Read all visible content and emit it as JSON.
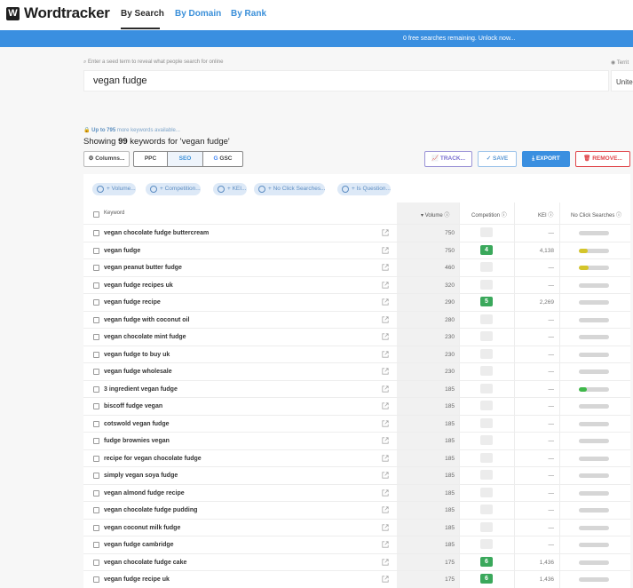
{
  "app": {
    "logo_mark": "W",
    "logo_text": "Wordtracker",
    "tabs": [
      {
        "label": "By Search",
        "active": true
      },
      {
        "label": "By Domain",
        "active": false
      },
      {
        "label": "By Rank",
        "active": false
      }
    ]
  },
  "banner": {
    "text": "0 free searches remaining. Unlock now..."
  },
  "search": {
    "hint": "Enter a seed term to reveal what people search for online",
    "value": "vegan fudge",
    "territory_hint": "Territ",
    "territory_value": "Unite"
  },
  "results": {
    "available_prefix": "Up to 795",
    "available_suffix": " more keywords available...",
    "showing_prefix": "Showing ",
    "showing_count": "99",
    "showing_suffix": " keywords for 'vegan fudge'"
  },
  "toolbar": {
    "columns_label": "Columns...",
    "ppc_label": "PPC",
    "seo_label": "SEO",
    "gsc_label": "GSC",
    "track_label": "TRACK...",
    "save_label": "SAVE",
    "export_label": "EXPORT",
    "remove_label": "REMOVE..."
  },
  "filters": [
    "+ Volume...",
    "+ Competition...",
    "+ KEI...",
    "+ No Click Searches...",
    "+ Is Question..."
  ],
  "table": {
    "headers": {
      "keyword": "Keyword",
      "volume": "Volume",
      "competition": "Competition",
      "kei": "KEI",
      "no_click": "No Click Searches"
    },
    "rows": [
      {
        "keyword": "vegan chocolate fudge buttercream",
        "volume": "750",
        "competition": "",
        "kei": "—",
        "no_click": 0,
        "bar_color": ""
      },
      {
        "keyword": "vegan fudge",
        "volume": "750",
        "competition": "4",
        "kei": "4,138",
        "no_click": 0.28,
        "bar_color": "#d4c52a"
      },
      {
        "keyword": "vegan peanut butter fudge",
        "volume": "460",
        "competition": "",
        "kei": "—",
        "no_click": 0.32,
        "bar_color": "#d4c52a"
      },
      {
        "keyword": "vegan fudge recipes uk",
        "volume": "320",
        "competition": "",
        "kei": "—",
        "no_click": 0,
        "bar_color": ""
      },
      {
        "keyword": "vegan fudge recipe",
        "volume": "290",
        "competition": "5",
        "kei": "2,269",
        "no_click": 0,
        "bar_color": ""
      },
      {
        "keyword": "vegan fudge with coconut oil",
        "volume": "280",
        "competition": "",
        "kei": "—",
        "no_click": 0,
        "bar_color": ""
      },
      {
        "keyword": "vegan chocolate mint fudge",
        "volume": "230",
        "competition": "",
        "kei": "—",
        "no_click": 0,
        "bar_color": ""
      },
      {
        "keyword": "vegan fudge to buy uk",
        "volume": "230",
        "competition": "",
        "kei": "—",
        "no_click": 0,
        "bar_color": ""
      },
      {
        "keyword": "vegan fudge wholesale",
        "volume": "230",
        "competition": "",
        "kei": "—",
        "no_click": 0,
        "bar_color": ""
      },
      {
        "keyword": "3 ingredient vegan fudge",
        "volume": "185",
        "competition": "",
        "kei": "—",
        "no_click": 0.25,
        "bar_color": "#3fb84a"
      },
      {
        "keyword": "biscoff fudge vegan",
        "volume": "185",
        "competition": "",
        "kei": "—",
        "no_click": 0,
        "bar_color": ""
      },
      {
        "keyword": "cotswold vegan fudge",
        "volume": "185",
        "competition": "",
        "kei": "—",
        "no_click": 0,
        "bar_color": ""
      },
      {
        "keyword": "fudge brownies vegan",
        "volume": "185",
        "competition": "",
        "kei": "—",
        "no_click": 0,
        "bar_color": ""
      },
      {
        "keyword": "recipe for vegan chocolate fudge",
        "volume": "185",
        "competition": "",
        "kei": "—",
        "no_click": 0,
        "bar_color": ""
      },
      {
        "keyword": "simply vegan soya fudge",
        "volume": "185",
        "competition": "",
        "kei": "—",
        "no_click": 0,
        "bar_color": ""
      },
      {
        "keyword": "vegan almond fudge recipe",
        "volume": "185",
        "competition": "",
        "kei": "—",
        "no_click": 0,
        "bar_color": ""
      },
      {
        "keyword": "vegan chocolate fudge pudding",
        "volume": "185",
        "competition": "",
        "kei": "—",
        "no_click": 0,
        "bar_color": ""
      },
      {
        "keyword": "vegan coconut milk fudge",
        "volume": "185",
        "competition": "",
        "kei": "—",
        "no_click": 0,
        "bar_color": ""
      },
      {
        "keyword": "vegan fudge cambridge",
        "volume": "185",
        "competition": "",
        "kei": "—",
        "no_click": 0,
        "bar_color": ""
      },
      {
        "keyword": "vegan chocolate fudge cake",
        "volume": "175",
        "competition": "6",
        "kei": "1,436",
        "no_click": 0,
        "bar_color": ""
      },
      {
        "keyword": "vegan fudge recipe uk",
        "volume": "175",
        "competition": "6",
        "kei": "1,436",
        "no_click": 0,
        "bar_color": ""
      }
    ]
  },
  "colors": {
    "brand_blue": "#3a8fe0",
    "competition_green": "#3aa85b",
    "export_blue": "#3a8fe0",
    "remove_red": "#e0454a",
    "track_purple": "#7a6fd0"
  }
}
